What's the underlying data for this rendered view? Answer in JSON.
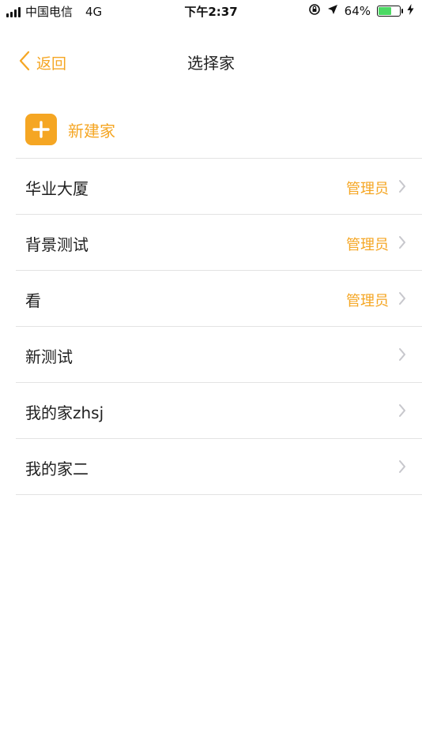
{
  "status_bar": {
    "carrier": "中国电信",
    "network": "4G",
    "time": "下午2:37",
    "battery_percent": "64%",
    "battery_level": 0.64,
    "battery_color": "#4cd964"
  },
  "nav": {
    "back_label": "返回",
    "title": "选择家"
  },
  "new_home": {
    "label": "新建家"
  },
  "homes": [
    {
      "name": "华业大厦",
      "role": "管理员"
    },
    {
      "name": "背景测试",
      "role": "管理员"
    },
    {
      "name": "看",
      "role": "管理员"
    },
    {
      "name": "新测试",
      "role": ""
    },
    {
      "name": "我的家zhsj",
      "role": ""
    },
    {
      "name": "我的家二",
      "role": ""
    }
  ],
  "colors": {
    "accent": "#f5a623",
    "divider": "#e3e3e3",
    "chevron": "#c7c7cc"
  },
  "icons": {
    "back": "chevron-left-icon",
    "add": "plus-icon",
    "row_arrow": "chevron-right-icon",
    "location": "location-arrow-icon",
    "rotation_lock": "rotation-lock-icon",
    "charging": "charging-bolt-icon"
  }
}
